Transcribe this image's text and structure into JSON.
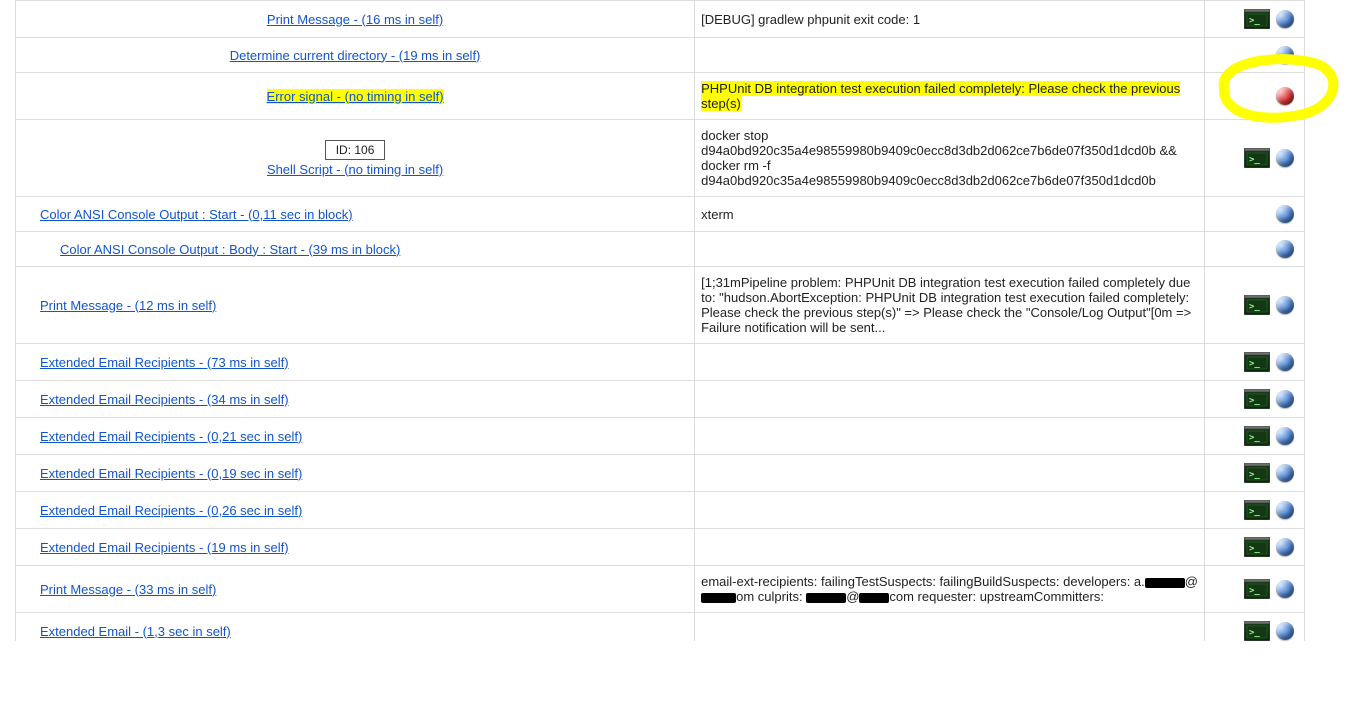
{
  "rows": [
    {
      "indent": "indent-1",
      "center": true,
      "link": "Print Message - (16 ms in self)",
      "msg": "[DEBUG] gradlew phpunit exit code: 1",
      "term": true,
      "ballColor": "blue"
    },
    {
      "indent": "indent-1",
      "center": true,
      "link": "Determine current directory - (19 ms in self)",
      "msg": "",
      "term": false,
      "ballColor": "blue"
    },
    {
      "indent": "indent-1",
      "center": true,
      "link": "Error signal - (no timing in self)",
      "linkHighlight": true,
      "msg": "PHPUnit DB integration test execution failed completely: Please check the previous step(s)",
      "msgHighlight": true,
      "term": false,
      "ballColor": "red",
      "yellowCircle": true
    },
    {
      "indent": "indent-1",
      "center": false,
      "shell": true,
      "badge": "ID: 106",
      "link": "Shell Script - (no timing in self)",
      "msg": "docker stop d94a0bd920c35a4e98559980b9409c0ecc8d3db2d062ce7b6de07f350d1dcd0b && docker rm -f d94a0bd920c35a4e98559980b9409c0ecc8d3db2d062ce7b6de07f350d1dcd0b",
      "term": true,
      "ballColor": "blue"
    },
    {
      "indent": "indent-0",
      "link": "Color ANSI Console Output : Start - (0,11 sec in block)",
      "msg": "xterm",
      "term": false,
      "ballColor": "blue"
    },
    {
      "indent": "indent-0b",
      "link": "Color ANSI Console Output : Body : Start - (39 ms in block)",
      "msg": "",
      "term": false,
      "ballColor": "blue"
    },
    {
      "indent": "indent-0",
      "link": "Print Message - (12 ms in self)",
      "msg": "[1;31mPipeline problem: PHPUnit DB integration test execution failed completely due to: \"hudson.AbortException: PHPUnit DB integration test execution failed completely: Please check the previous step(s)\" => Please check the \"Console/Log Output\"[0m => Failure notification will be sent...",
      "term": true,
      "ballColor": "blue"
    },
    {
      "indent": "indent-0",
      "link": "Extended Email Recipients - (73 ms in self)",
      "msg": "",
      "term": true,
      "ballColor": "blue"
    },
    {
      "indent": "indent-0",
      "link": "Extended Email Recipients - (34 ms in self)",
      "msg": "",
      "term": true,
      "ballColor": "blue"
    },
    {
      "indent": "indent-0",
      "link": "Extended Email Recipients - (0,21 sec in self)",
      "msg": "",
      "term": true,
      "ballColor": "blue"
    },
    {
      "indent": "indent-0",
      "link": "Extended Email Recipients - (0,19 sec in self)",
      "msg": "",
      "term": true,
      "ballColor": "blue"
    },
    {
      "indent": "indent-0",
      "link": "Extended Email Recipients - (0,26 sec in self)",
      "msg": "",
      "term": true,
      "ballColor": "blue"
    },
    {
      "indent": "indent-0",
      "link": "Extended Email Recipients - (19 ms in self)",
      "msg": "",
      "term": true,
      "ballColor": "blue"
    },
    {
      "indent": "indent-0",
      "link": "Print Message - (33 ms in self)",
      "msgRedacted": true,
      "msgParts": [
        "email-ext-recipients: failingTestSuspects: failingBuildSuspects: developers: a.",
        "om culprits: ",
        "com requester: upstreamCommitters:"
      ],
      "term": true,
      "ballColor": "blue"
    },
    {
      "indent": "indent-0",
      "link": "Extended Email - (1,3 sec in self)",
      "msg": "",
      "term": true,
      "ballColor": "blue",
      "partial": true
    }
  ]
}
